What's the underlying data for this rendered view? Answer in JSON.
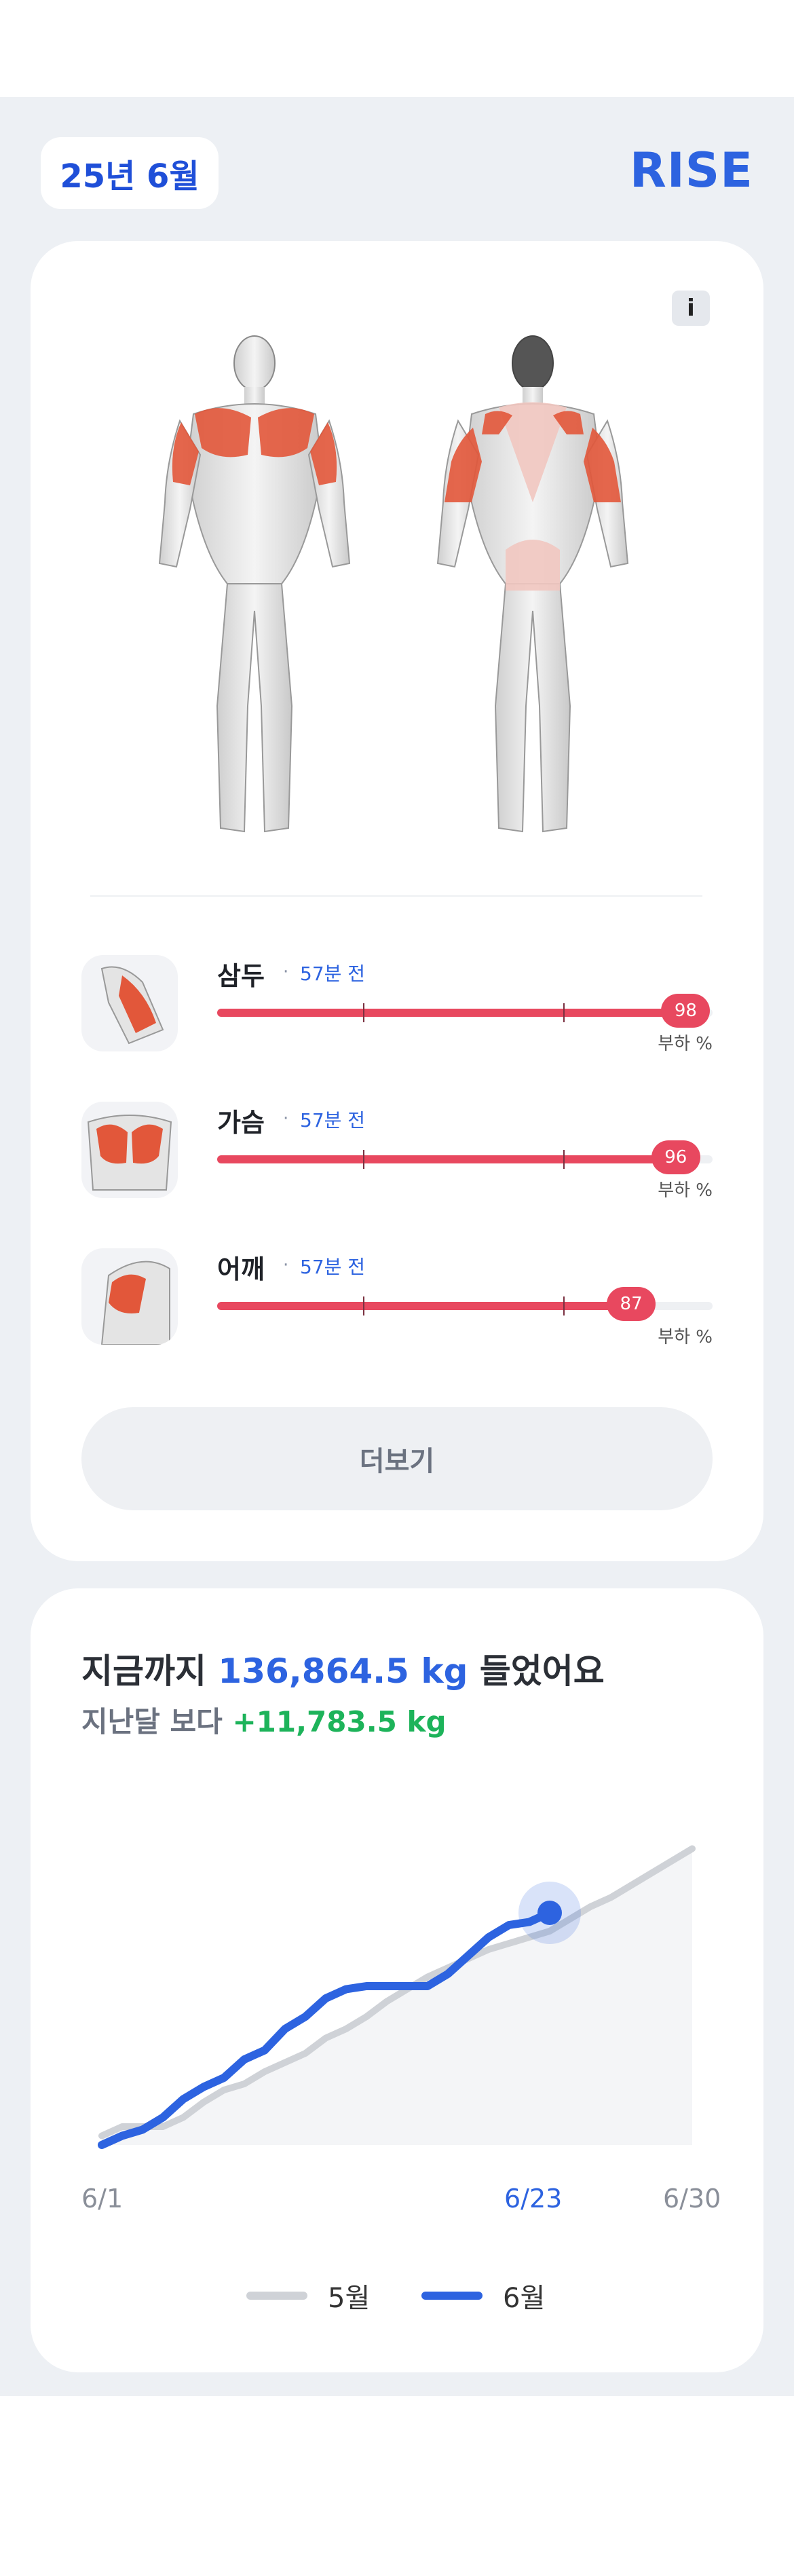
{
  "header": {
    "month_label": "25년 6월",
    "brand": "RISE"
  },
  "muscle_card": {
    "info_label": "i",
    "muscles": [
      {
        "name": "삼두",
        "separator": "·",
        "time_ago": "57분 전",
        "load_percent": 98,
        "load_label": "부하 %"
      },
      {
        "name": "가슴",
        "separator": "·",
        "time_ago": "57분 전",
        "load_percent": 96,
        "load_label": "부하 %"
      },
      {
        "name": "어깨",
        "separator": "·",
        "time_ago": "57분 전",
        "load_percent": 87,
        "load_label": "부하 %"
      }
    ],
    "more_button": "더보기"
  },
  "volume_card": {
    "headline_prefix": "지금까지 ",
    "total_volume": "136,864.5 kg",
    "headline_suffix": " 들었어요",
    "compare_prefix": "지난달 보다 ",
    "compare_delta": "+11,783.5 kg"
  },
  "colors": {
    "accent": "#2D63E0",
    "muscle_highlight": "#E8485F",
    "positive": "#1DB35A",
    "prev_month_line": "#CFD2D7"
  },
  "chart_data": {
    "type": "line",
    "x_labels": [
      "6/1",
      "6/23",
      "6/30"
    ],
    "highlight_label": "6/23",
    "series": [
      {
        "name": "5월",
        "color": "#CFD2D7",
        "x": [
          1,
          2,
          3,
          4,
          5,
          6,
          7,
          8,
          9,
          10,
          11,
          12,
          13,
          14,
          15,
          16,
          17,
          18,
          19,
          20,
          21,
          22,
          23,
          24,
          25,
          26,
          27,
          28,
          29,
          30
        ],
        "values": [
          3,
          6,
          6,
          6,
          9,
          14,
          18,
          20,
          24,
          27,
          30,
          35,
          38,
          42,
          47,
          51,
          55,
          58,
          61,
          64,
          66,
          68,
          70,
          74,
          78,
          81,
          85,
          89,
          93,
          97
        ]
      },
      {
        "name": "6월",
        "color": "#2D63E0",
        "x": [
          1,
          2,
          3,
          4,
          5,
          6,
          7,
          8,
          9,
          10,
          11,
          12,
          13,
          14,
          15,
          16,
          17,
          18,
          19,
          20,
          21,
          22,
          23
        ],
        "values": [
          0,
          3,
          5,
          9,
          15,
          19,
          22,
          28,
          31,
          38,
          42,
          48,
          51,
          52,
          52,
          52,
          52,
          56,
          62,
          68,
          72,
          73,
          76
        ]
      }
    ],
    "legend_position": "bottom-center"
  }
}
